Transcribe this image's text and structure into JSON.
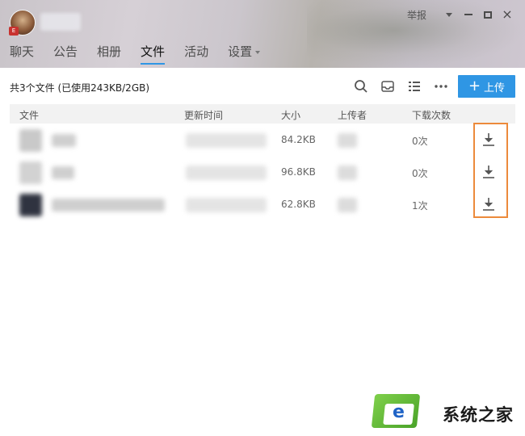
{
  "header": {
    "report_label": "举报",
    "close_glyph": "×"
  },
  "tabs": [
    {
      "label": "聊天"
    },
    {
      "label": "公告"
    },
    {
      "label": "相册"
    },
    {
      "label": "文件",
      "active": true
    },
    {
      "label": "活动"
    },
    {
      "label": "设置",
      "has_dropdown": true
    }
  ],
  "toolbar": {
    "summary": "共3个文件 (已使用243KB/2GB)",
    "upload_label": "上传",
    "icons": [
      "search-icon",
      "inbox-icon",
      "list-view-icon",
      "more-icon"
    ]
  },
  "table": {
    "columns": [
      "文件",
      "更新时间",
      "大小",
      "上传者",
      "下载次数"
    ],
    "rows": [
      {
        "size": "84.2KB",
        "downloads": "0次"
      },
      {
        "size": "96.8KB",
        "downloads": "0次"
      },
      {
        "size": "62.8KB",
        "downloads": "1次"
      }
    ]
  },
  "watermark": {
    "text": "系统之家"
  },
  "colors": {
    "accent": "#2f96e4",
    "highlight": "#ec8a3b"
  }
}
